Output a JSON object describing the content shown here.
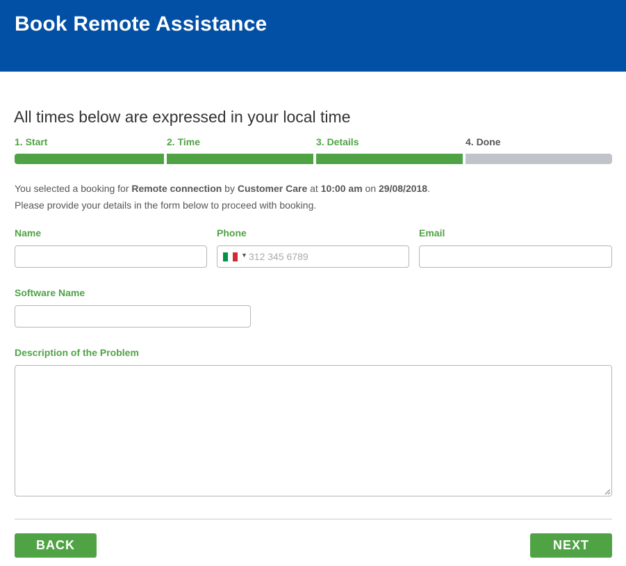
{
  "header": {
    "title": "Book Remote Assistance"
  },
  "subtitle": "All times below are expressed in your local time",
  "steps": [
    {
      "label": "1. Start",
      "state": "done"
    },
    {
      "label": "2. Time",
      "state": "done"
    },
    {
      "label": "3. Details",
      "state": "done"
    },
    {
      "label": "4. Done",
      "state": "pending"
    }
  ],
  "booking_info": {
    "prefix": "You selected a booking for ",
    "service": "Remote connection",
    "by_text": " by ",
    "provider": "Customer Care",
    "at_text": " at ",
    "time": "10:00 am",
    "on_text": " on ",
    "date": "29/08/2018",
    "suffix": ".",
    "line2": "Please provide your details in the form below to proceed with booking."
  },
  "form": {
    "name": {
      "label": "Name",
      "value": ""
    },
    "phone": {
      "label": "Phone",
      "value": "",
      "placeholder": "312 345 6789",
      "country_flag": "italy-flag-icon",
      "flag_colors": [
        "#009246",
        "#ffffff",
        "#ce2b37"
      ]
    },
    "email": {
      "label": "Email",
      "value": ""
    },
    "software": {
      "label": "Software Name",
      "value": ""
    },
    "description": {
      "label": "Description of the Problem",
      "value": ""
    }
  },
  "buttons": {
    "back": "BACK",
    "next": "NEXT"
  },
  "colors": {
    "header_bg": "#0250a5",
    "accent": "#4fa345",
    "pending": "#c0c4ca"
  }
}
